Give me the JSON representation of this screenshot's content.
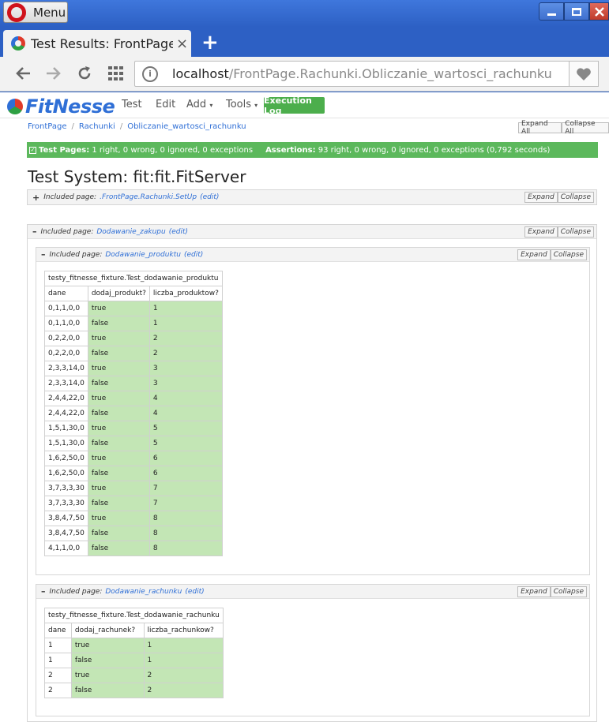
{
  "window": {
    "menu_label": "Menu"
  },
  "tab": {
    "title": "Test Results: FrontPage.Rac",
    "close": "×",
    "new_tab": "+"
  },
  "address": {
    "host": "localhost",
    "path": "/FrontPage.Rachunki.Obliczanie_wartosci_rachunku"
  },
  "fitnesse": {
    "logo": "FitNesse",
    "menu": [
      "Test",
      "Edit",
      "Add",
      "Tools"
    ],
    "execution_log": "Execution Log"
  },
  "breadcrumb": [
    "FrontPage",
    "Rachunki",
    "Obliczanie_wartosci_rachunku"
  ],
  "expand_all": "Expand All",
  "collapse_all": "Collapse All",
  "summary": {
    "pages_label": "Test Pages:",
    "pages_text": "1 right, 0 wrong, 0 ignored, 0 exceptions",
    "assertions_label": "Assertions:",
    "assertions_text": "93 right, 0 wrong, 0 ignored, 0 exceptions (0,792 seconds)",
    "color": "#5cb85c"
  },
  "test_system": "Test System: fit:fit.FitServer",
  "included_label": "Included page:",
  "expand": "Expand",
  "collapse": "Collapse",
  "edit": "(edit)",
  "setup": {
    "page": ".FrontPage.Rachunki.SetUp"
  },
  "zakupu": {
    "page": "Dodawanie_zakupu"
  },
  "produktu": {
    "page": "Dodawanie_produktu",
    "fixture": "testy_fitnesse_fixture.Test_dodawanie_produktu",
    "headers": [
      "dane",
      "dodaj_produkt?",
      "liczba_produktow?"
    ],
    "rows": [
      [
        "0,1,1,0,0",
        "true",
        "1"
      ],
      [
        "0,1,1,0,0",
        "false",
        "1"
      ],
      [
        "0,2,2,0,0",
        "true",
        "2"
      ],
      [
        "0,2,2,0,0",
        "false",
        "2"
      ],
      [
        "2,3,3,14,0",
        "true",
        "3"
      ],
      [
        "2,3,3,14,0",
        "false",
        "3"
      ],
      [
        "2,4,4,22,0",
        "true",
        "4"
      ],
      [
        "2,4,4,22,0",
        "false",
        "4"
      ],
      [
        "1,5,1,30,0",
        "true",
        "5"
      ],
      [
        "1,5,1,30,0",
        "false",
        "5"
      ],
      [
        "1,6,2,50,0",
        "true",
        "6"
      ],
      [
        "1,6,2,50,0",
        "false",
        "6"
      ],
      [
        "3,7,3,3,30",
        "true",
        "7"
      ],
      [
        "3,7,3,3,30",
        "false",
        "7"
      ],
      [
        "3,8,4,7,50",
        "true",
        "8"
      ],
      [
        "3,8,4,7,50",
        "false",
        "8"
      ],
      [
        "4,1,1,0,0",
        "false",
        "8"
      ]
    ]
  },
  "rachunku": {
    "page": "Dodawanie_rachunku",
    "fixture": "testy_fitnesse_fixture.Test_dodawanie_rachunku",
    "headers": [
      "dane",
      "dodaj_rachunek?",
      "liczba_rachunkow?"
    ],
    "rows": [
      [
        "1",
        "true",
        "1"
      ],
      [
        "1",
        "false",
        "1"
      ],
      [
        "2",
        "true",
        "2"
      ],
      [
        "2",
        "false",
        "2"
      ]
    ]
  }
}
